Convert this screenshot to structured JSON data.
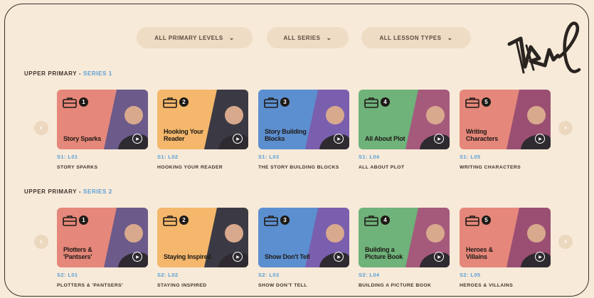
{
  "filters": [
    {
      "label": "ALL PRIMARY LEVELS",
      "icon": "chevron-down-icon"
    },
    {
      "label": "ALL SERIES",
      "icon": "chevron-down-icon"
    },
    {
      "label": "ALL LESSON TYPES",
      "icon": "chevron-down-icon"
    }
  ],
  "sections": [
    {
      "level": "UPPER PRIMARY -",
      "series": "SERIES 1",
      "prev_icon": "chevron-left-icon",
      "next_icon": "chevron-right-icon",
      "lessons": [
        {
          "number": "1",
          "thumb_title": "Story Sparks",
          "code": "S1: L01",
          "name": "STORY SPARKS",
          "color": "#e5877a"
        },
        {
          "number": "2",
          "thumb_title": "Hooking Your Reader",
          "code": "S1: L02",
          "name": "HOOKING YOUR READER",
          "color": "#f4b76c"
        },
        {
          "number": "3",
          "thumb_title": "Story Building Blocks",
          "code": "S1: L03",
          "name": "THE STORY BUILDING BLOCKS",
          "color": "#5c8fd0"
        },
        {
          "number": "4",
          "thumb_title": "All About Plot",
          "code": "S1: L04",
          "name": "ALL ABOUT PLOT",
          "color": "#6fb27a"
        },
        {
          "number": "5",
          "thumb_title": "Writing Characters",
          "code": "S1: L05",
          "name": "WRITING CHARACTERS",
          "color": "#e5877a"
        }
      ]
    },
    {
      "level": "UPPER PRIMARY -",
      "series": "SERIES 2",
      "prev_icon": "chevron-left-icon",
      "next_icon": "chevron-right-icon",
      "lessons": [
        {
          "number": "1",
          "thumb_title": "Plotters & 'Pantsers'",
          "code": "S2: L01",
          "name": "PLOTTERS & 'PANTSERS'",
          "color": "#e5877a"
        },
        {
          "number": "2",
          "thumb_title": "Staying Inspired",
          "code": "S2: L02",
          "name": "STAYING INSPIRED",
          "color": "#f4b76c"
        },
        {
          "number": "3",
          "thumb_title": "Show Don't Tell",
          "code": "S2: L03",
          "name": "SHOW DON'T TELL",
          "color": "#5c8fd0"
        },
        {
          "number": "4",
          "thumb_title": "Building a Picture Book",
          "code": "S2: L04",
          "name": "BUILDING A PICTURE BOOK",
          "color": "#6fb27a"
        },
        {
          "number": "5",
          "thumb_title": "Heroes & Villains",
          "code": "S2: L05",
          "name": "HEROES & VILLAINS",
          "color": "#e5877a"
        }
      ]
    }
  ],
  "colors": {
    "background": "#f7ead9",
    "accent_blue": "#5a9fd6",
    "filter_bg": "#efdcc4"
  }
}
